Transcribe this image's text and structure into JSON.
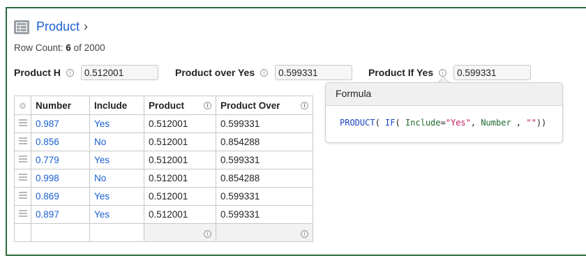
{
  "header": {
    "title": "Product",
    "chevron": "›",
    "row_count_prefix": "Row Count: ",
    "row_count": "6",
    "row_count_suffix": " of 2000"
  },
  "params": [
    {
      "label": "Product H",
      "value": "0.512001"
    },
    {
      "label": "Product over Yes",
      "value": "0.599331"
    },
    {
      "label": "Product If Yes",
      "value": "0.599331"
    }
  ],
  "table": {
    "headers": [
      "Number",
      "Include",
      "Product",
      "Product Over"
    ],
    "rows": [
      {
        "number": "0.987",
        "include": "Yes",
        "product": "0.512001",
        "product_over": "0.599331"
      },
      {
        "number": "0.856",
        "include": "No",
        "product": "0.512001",
        "product_over": "0.854288"
      },
      {
        "number": "0.779",
        "include": "Yes",
        "product": "0.512001",
        "product_over": "0.599331"
      },
      {
        "number": "0.998",
        "include": "No",
        "product": "0.512001",
        "product_over": "0.854288"
      },
      {
        "number": "0.869",
        "include": "Yes",
        "product": "0.512001",
        "product_over": "0.599331"
      },
      {
        "number": "0.897",
        "include": "Yes",
        "product": "0.512001",
        "product_over": "0.599331"
      }
    ]
  },
  "formula": {
    "title": "Formula",
    "parts": {
      "fn1": "PRODUCT",
      "p1": "( ",
      "fn2": "IF",
      "p2": "( ",
      "id1": "Include",
      "p3": "=",
      "str1": "\"Yes\"",
      "p4": ", ",
      "id2": "Number",
      "p5": " , ",
      "str2": "\"\"",
      "p6": "))"
    }
  },
  "colors": {
    "link": "#1a5fd1",
    "frame": "#2e6b3a"
  },
  "icons": {
    "table": "table-icon",
    "info": "info-icon",
    "gear": "gear-icon",
    "handle": "drag-handle-icon"
  }
}
